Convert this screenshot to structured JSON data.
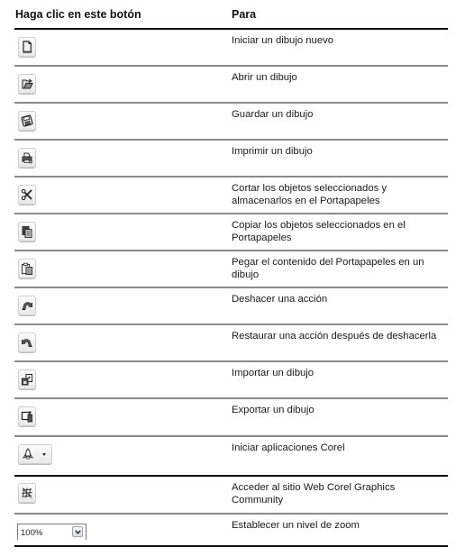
{
  "table": {
    "header": {
      "button_column": "Haga clic en este botón",
      "purpose_column": "Para"
    },
    "rows": [
      {
        "icon": "new-document-icon",
        "description": "Iniciar un dibujo nuevo"
      },
      {
        "icon": "open-folder-icon",
        "description": "Abrir un dibujo"
      },
      {
        "icon": "save-disk-icon",
        "description": "Guardar un dibujo"
      },
      {
        "icon": "printer-icon",
        "description": "Imprimir un dibujo"
      },
      {
        "icon": "scissors-icon",
        "description": "Cortar los objetos seleccionados y almacenarlos en el Portapapeles"
      },
      {
        "icon": "copy-icon",
        "description": "Copiar los objetos seleccionados en el Portapapeles"
      },
      {
        "icon": "paste-icon",
        "description": "Pegar el contenido del Portapapeles en un dibujo"
      },
      {
        "icon": "undo-icon",
        "description": "Deshacer una acción"
      },
      {
        "icon": "redo-icon",
        "description": "Restaurar una acción después de deshacerla"
      },
      {
        "icon": "import-icon",
        "description": "Importar un dibujo"
      },
      {
        "icon": "export-icon",
        "description": "Exportar un dibujo"
      },
      {
        "icon": "application-launcher-icon",
        "description": "Iniciar aplicaciones Corel"
      },
      {
        "icon": "corel-community-icon",
        "description": "Acceder al sitio Web Corel Graphics Community"
      },
      {
        "icon": "zoom-level-select",
        "description": "Establecer un nivel de zoom",
        "zoom_value": "100%"
      }
    ]
  }
}
